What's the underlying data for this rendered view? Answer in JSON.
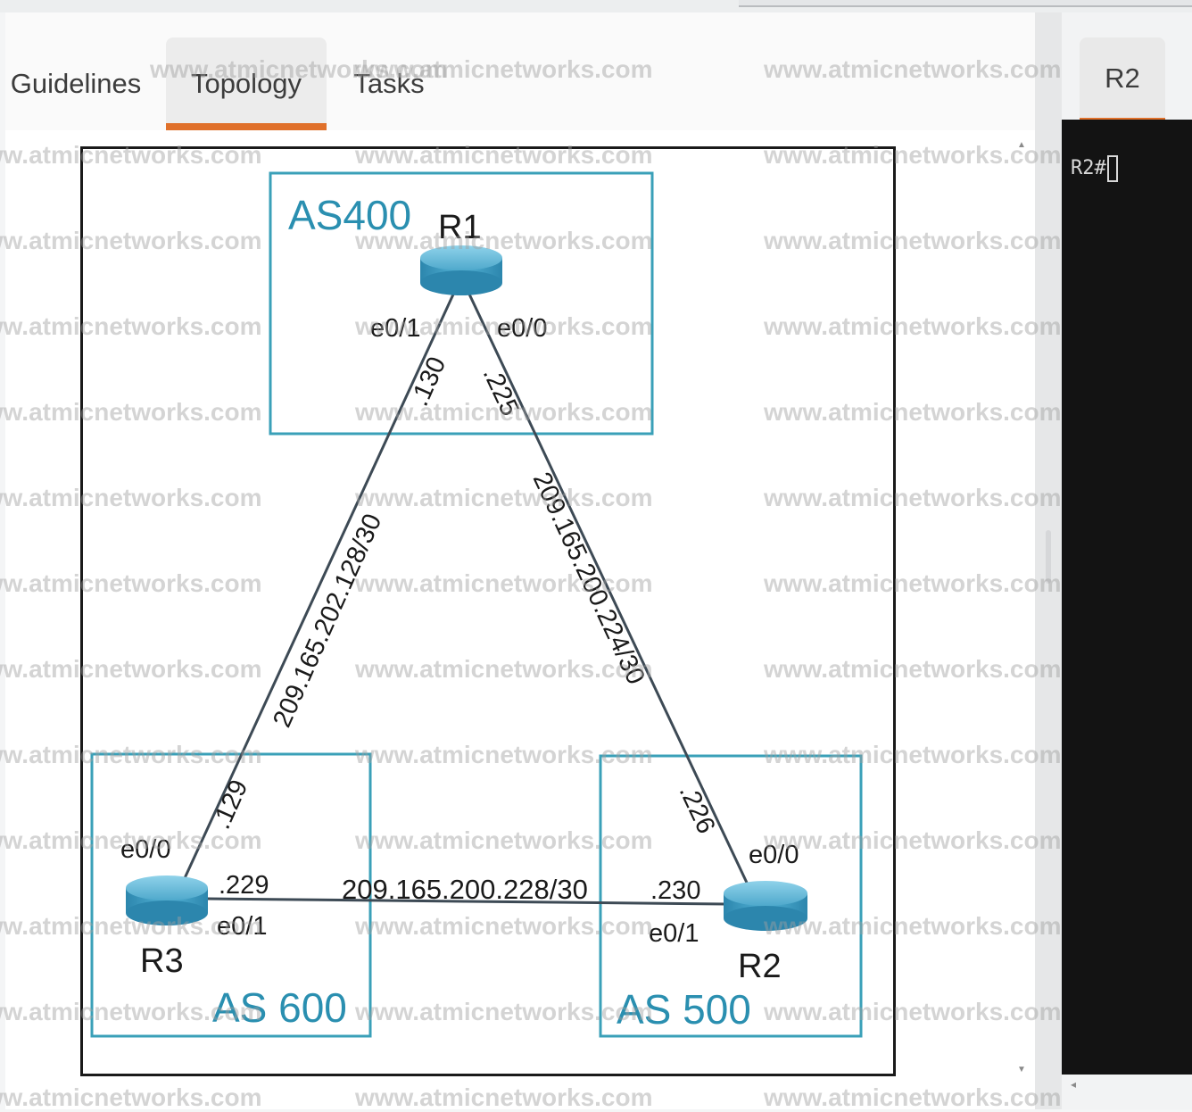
{
  "tabs": [
    {
      "label": "Guidelines",
      "active": false
    },
    {
      "label": "Topology",
      "active": true
    },
    {
      "label": "Tasks",
      "active": false
    }
  ],
  "console": {
    "tab_label": "R2",
    "prompt": "R2#"
  },
  "topology": {
    "areas": [
      {
        "label": "AS400"
      },
      {
        "label": "AS 600"
      },
      {
        "label": "AS 500"
      }
    ],
    "routers": [
      {
        "name": "R1"
      },
      {
        "name": "R3"
      },
      {
        "name": "R2"
      }
    ],
    "links": [
      {
        "subnet": "209.165.202.128/30",
        "a_intf": "e0/1",
        "a_host": ".130",
        "b_intf": "e0/0",
        "b_host": ".129"
      },
      {
        "subnet": "209.165.200.224/30",
        "a_intf": "e0/0",
        "a_host": ".225",
        "b_intf": "e0/0",
        "b_host": ".226"
      },
      {
        "subnet": "209.165.200.228/30",
        "a_intf": "e0/1",
        "a_host": ".229",
        "b_intf": "e0/1",
        "b_host": ".230"
      }
    ]
  },
  "watermark": "www.atmicnetworks.com",
  "colors": {
    "accent_tab": "#e0702a",
    "as_box": "#3aa0b8",
    "as_label": "#2a8fb0",
    "router": "#3b9fc4",
    "terminal_bg": "#131313"
  }
}
